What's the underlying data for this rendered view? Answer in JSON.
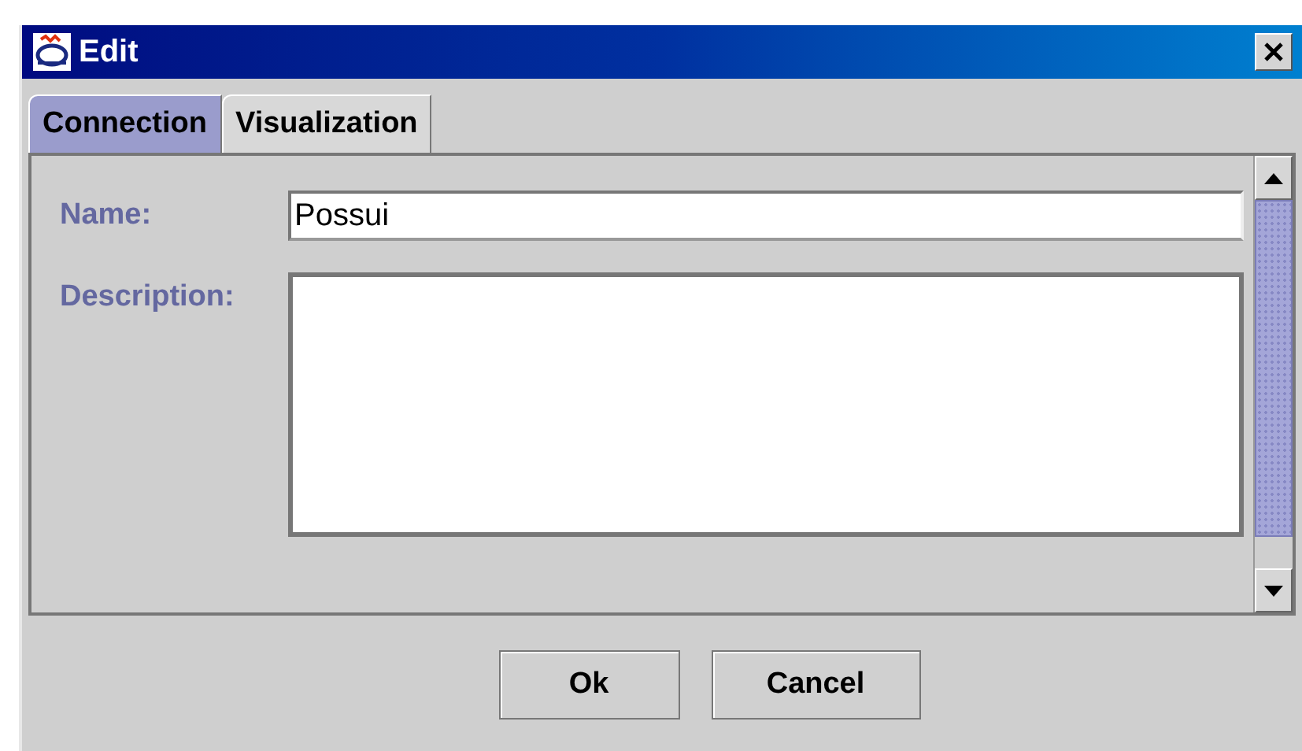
{
  "window": {
    "title": "Edit"
  },
  "tabs": [
    {
      "label": "Connection",
      "selected": true
    },
    {
      "label": "Visualization",
      "selected": false
    }
  ],
  "form": {
    "name_label": "Name:",
    "name_value": "Possui",
    "description_label": "Description:"
  },
  "buttons": [
    "Ok",
    "Cancel"
  ]
}
